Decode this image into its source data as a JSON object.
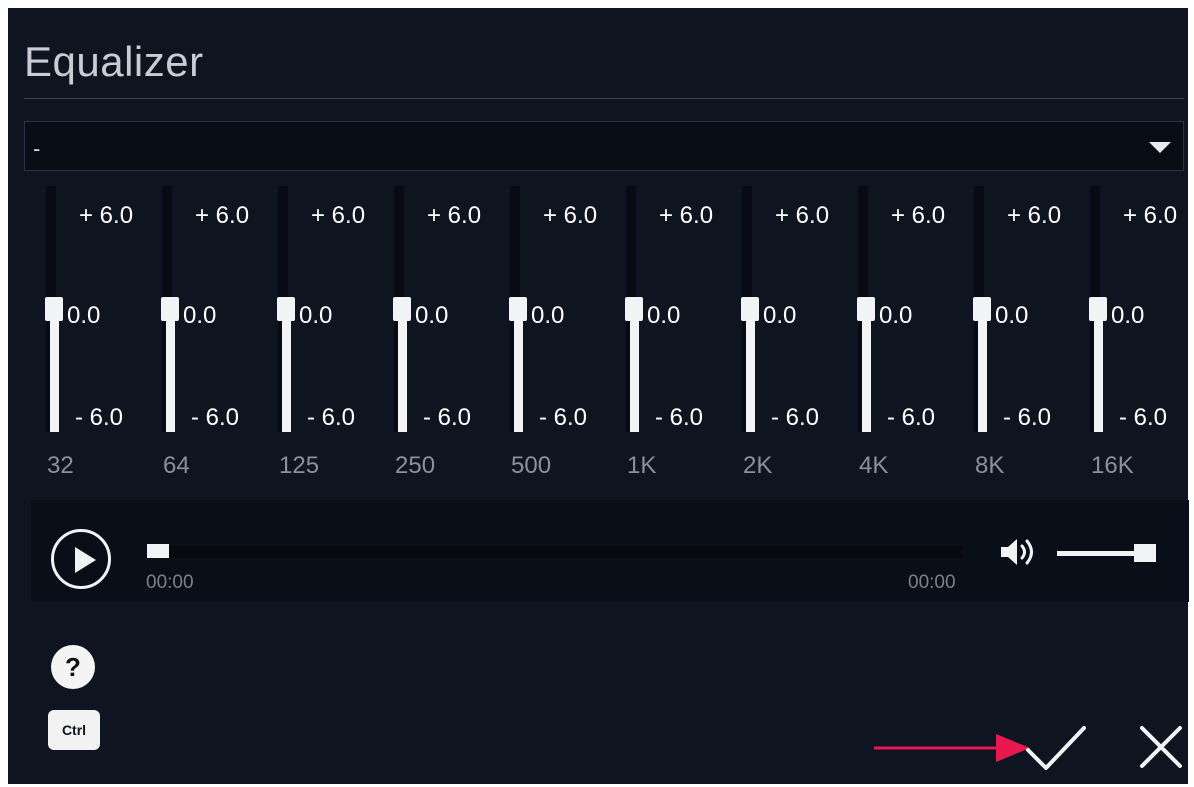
{
  "window": {
    "title": "Equalizer"
  },
  "preset": {
    "value": "-"
  },
  "bands": [
    {
      "freq": "32",
      "max_label": "+ 6.0",
      "value_label": "0.0",
      "min_label": "- 6.0",
      "value": 0.0
    },
    {
      "freq": "64",
      "max_label": "+ 6.0",
      "value_label": "0.0",
      "min_label": "- 6.0",
      "value": 0.0
    },
    {
      "freq": "125",
      "max_label": "+ 6.0",
      "value_label": "0.0",
      "min_label": "- 6.0",
      "value": 0.0
    },
    {
      "freq": "250",
      "max_label": "+ 6.0",
      "value_label": "0.0",
      "min_label": "- 6.0",
      "value": 0.0
    },
    {
      "freq": "500",
      "max_label": "+ 6.0",
      "value_label": "0.0",
      "min_label": "- 6.0",
      "value": 0.0
    },
    {
      "freq": "1K",
      "max_label": "+ 6.0",
      "value_label": "0.0",
      "min_label": "- 6.0",
      "value": 0.0
    },
    {
      "freq": "2K",
      "max_label": "+ 6.0",
      "value_label": "0.0",
      "min_label": "- 6.0",
      "value": 0.0
    },
    {
      "freq": "4K",
      "max_label": "+ 6.0",
      "value_label": "0.0",
      "min_label": "- 6.0",
      "value": 0.0
    },
    {
      "freq": "8K",
      "max_label": "+ 6.0",
      "value_label": "0.0",
      "min_label": "- 6.0",
      "value": 0.0
    },
    {
      "freq": "16K",
      "max_label": "+ 6.0",
      "value_label": "0.0",
      "min_label": "- 6.0",
      "value": 0.0
    }
  ],
  "band_range": {
    "min": -6.0,
    "max": 6.0
  },
  "player": {
    "time_current": "00:00",
    "time_total": "00:00",
    "seek_progress": 0,
    "volume_level": 1.0
  },
  "footer": {
    "help_label": "?",
    "ctrl_label": "Ctrl"
  },
  "icons": {
    "play": "play-circle-icon",
    "volume": "speaker-volume-icon",
    "confirm": "checkmark-icon",
    "close": "x-close-icon",
    "dropdown": "caret-down-icon",
    "pointer": "red-arrow-pointer"
  },
  "colors": {
    "background": "#0f1421",
    "accent_arrow": "#e8194f",
    "control": "#f2f3f5"
  }
}
